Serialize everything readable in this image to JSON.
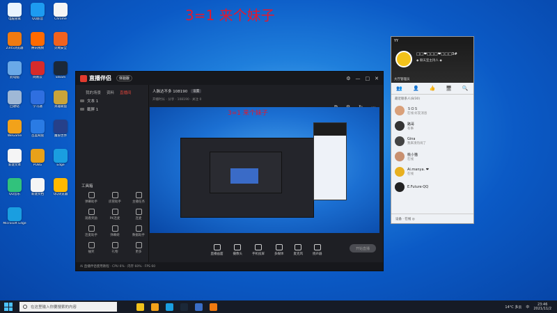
{
  "headline": "3=1 来个妹子",
  "desktop_icons": [
    {
      "label": "电脑管家",
      "color": "#e9f4ff"
    },
    {
      "label": "QQ影音",
      "color": "#1d9bf0"
    },
    {
      "label": "Chrome",
      "color": "#f5f5f5"
    },
    {
      "label": "2345浏览器",
      "color": "#f07a10"
    },
    {
      "label": "腾讯视频",
      "color": "#ff6a00"
    },
    {
      "label": "火绒安全",
      "color": "#f1621e"
    },
    {
      "label": "此电脑",
      "color": "#6aa9e8"
    },
    {
      "label": "网易云",
      "color": "#d62b2b"
    },
    {
      "label": "Steam",
      "color": "#1b2838"
    },
    {
      "label": "回收站",
      "color": "#9fb8d6"
    },
    {
      "label": "学习通",
      "color": "#2f6fe0"
    },
    {
      "label": "英雄联盟",
      "color": "#c9a43a"
    },
    {
      "label": "WeGame",
      "color": "#f2a21a"
    },
    {
      "label": "百度网盘",
      "color": "#2a7be4"
    },
    {
      "label": "魔兽世界",
      "color": "#26408a"
    },
    {
      "label": "新建文本",
      "color": "#f5f5f5"
    },
    {
      "label": "PUBG",
      "color": "#e8a11a"
    },
    {
      "label": "Edge",
      "color": "#1a9ee0"
    },
    {
      "label": "QQ音乐",
      "color": "#31c27c"
    },
    {
      "label": "新建文档",
      "color": "#f5f5f5"
    },
    {
      "label": "QQ浏览器",
      "color": "#ffb900"
    },
    {
      "label": "Microsoft Edge",
      "color": "#1a9ee0"
    }
  ],
  "app": {
    "name": "直播伴侣",
    "pill": "体验版",
    "tabs": [
      "我的场景",
      "资料",
      "直播间"
    ],
    "active_tab": "直播间",
    "scenes": [
      "文本 1",
      "截屏 1"
    ],
    "room_title": "人脉达不多 108190",
    "room_badge": "设置",
    "room_sub": "开播时长 · 分享 · 108190 · 关注 0",
    "tools_title": "工具箱",
    "tools": [
      "弹幕助手",
      "房管助手",
      "主播任务",
      "观看奖励",
      "PK连麦",
      "连麦",
      "连麦助手",
      "弹幕姬",
      "数据助手",
      "抽奖",
      "礼物",
      "更多"
    ],
    "inner_title": "3=1 来个妹子",
    "bottom_tools": [
      "直播画面",
      "摄像头",
      "手机投屏",
      "多媒体",
      "麦克风",
      "扬声器"
    ],
    "start_label": "开始直播",
    "status": "Ai 直播伴侣使用教程 · CPU 6% · 内存 60% · FPS 60",
    "side_icons": [
      "⧉",
      "⚙",
      "↻",
      "⋯"
    ]
  },
  "chat": {
    "window_label": "YY",
    "user_name": "□□❤□□□❤□□□3#",
    "signature": "◆ 聊天室主持人 ◆",
    "sub_label": "大厅管理员",
    "tabs": [
      "👥",
      "👤",
      "👍",
      "🖥",
      "🔍"
    ],
    "count": "最近联系人(8/30)",
    "members": [
      {
        "name": "ＳＯＳ",
        "status": "在线·好友消息",
        "color": "#d9a07a"
      },
      {
        "name": "路哥",
        "status": "有事",
        "color": "#333"
      },
      {
        "name": "Gina",
        "status": "我来凑热闹了",
        "color": "#444"
      },
      {
        "name": "桃小猫",
        "status": "在线",
        "color": "#c89070"
      },
      {
        "name": "Ai.manya. ❤",
        "status": "在线",
        "color": "#e8b020"
      },
      {
        "name": "E.Future·QQ",
        "status": "",
        "color": "#222"
      }
    ],
    "footer": "设备 · 在线 ◎"
  },
  "taskbar": {
    "search_placeholder": "在这里输入你要搜索的内容",
    "apps": [
      "#f2c21b",
      "#f2a21a",
      "#1a9ee0",
      "#1b2838",
      "#3a6ec7",
      "#f07a10"
    ],
    "weather": "14°C 多云",
    "ime": "中",
    "time": "23:46",
    "date": "2021/11/2"
  }
}
